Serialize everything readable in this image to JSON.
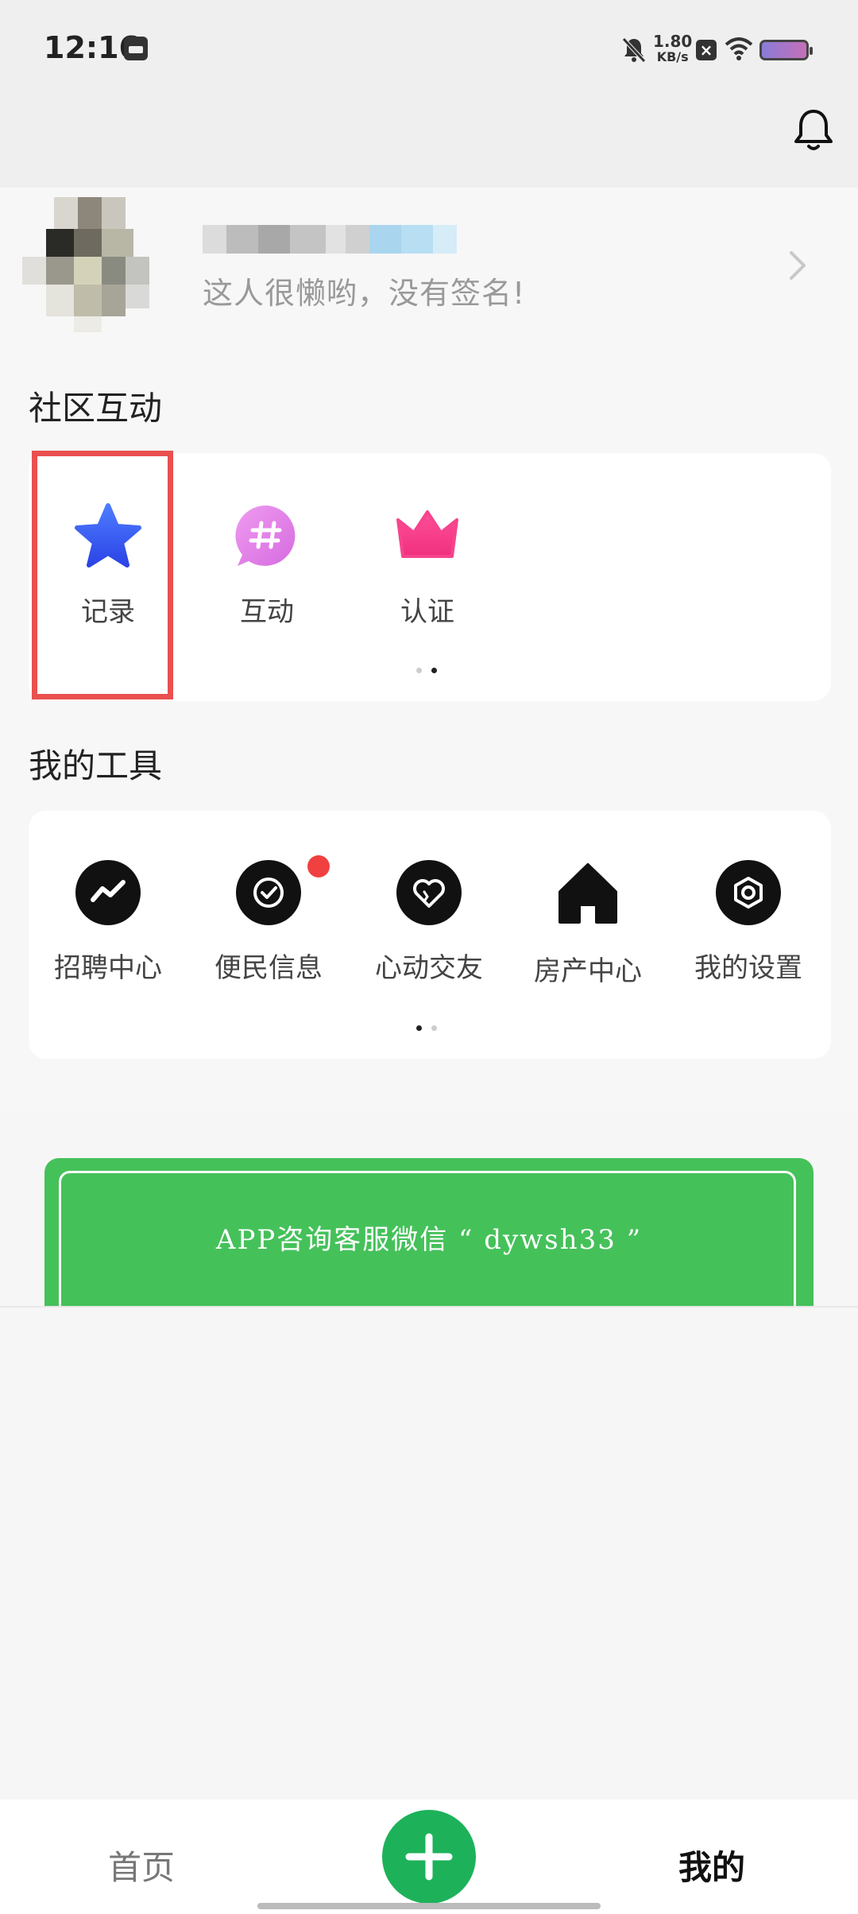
{
  "status_bar": {
    "time": "12:16",
    "net_speed_value": "1.80",
    "net_speed_unit": "KB/s"
  },
  "profile": {
    "signature": "这人很懒哟，没有签名!"
  },
  "community": {
    "title": "社区互动",
    "items": [
      {
        "label": "记录",
        "icon": "star-icon"
      },
      {
        "label": "互动",
        "icon": "hashtag-chat-icon"
      },
      {
        "label": "认证",
        "icon": "crown-icon"
      }
    ],
    "page_indicator": {
      "count": 2,
      "active": 2
    }
  },
  "tools": {
    "title": "我的工具",
    "items": [
      {
        "label": "招聘中心",
        "icon": "trend-icon"
      },
      {
        "label": "便民信息",
        "icon": "check-circle-icon",
        "has_badge": true
      },
      {
        "label": "心动交友",
        "icon": "heart-icon"
      },
      {
        "label": "房产中心",
        "icon": "house-icon"
      },
      {
        "label": "我的设置",
        "icon": "settings-icon"
      }
    ],
    "page_indicator": {
      "count": 2,
      "active": 1
    }
  },
  "banner": {
    "text": "APP咨询客服微信 “ dywsh33 ”",
    "color": "#45c15a"
  },
  "bottom_nav": {
    "home_label": "首页",
    "add_icon": "plus-icon",
    "mine_label": "我的"
  },
  "colors": {
    "highlight": "#e9504f",
    "accent_green": "#1db25a",
    "badge_red": "#f04040"
  }
}
